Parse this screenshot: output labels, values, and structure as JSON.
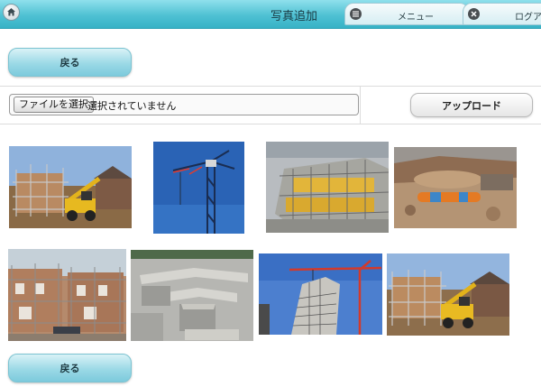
{
  "header": {
    "title": "写真追加",
    "home_icon": "home-icon",
    "tabs": [
      {
        "label": "メニュー",
        "icon": "menu-icon"
      },
      {
        "label": "ログアウト",
        "icon": "close-icon"
      }
    ],
    "colors": {
      "bar": "#4fc1d3",
      "tab": "#eaf7fa"
    }
  },
  "back_button": {
    "label": "戻る"
  },
  "upload_form": {
    "file_button_label": "ファイルを選択",
    "file_status": "選択されていません",
    "upload_button_label": "アップロード"
  },
  "photos": [
    {
      "subject": "scaffolding with yellow telehandler and houses"
    },
    {
      "subject": "blue tower crane against blue sky"
    },
    {
      "subject": "scaffolded building with yellow safety nets"
    },
    {
      "subject": "excavation with orange pipe"
    },
    {
      "subject": "brick houses under scaffolding"
    },
    {
      "subject": "concrete foundation forms"
    },
    {
      "subject": "tall building with red crane"
    },
    {
      "subject": "scaffolding with yellow telehandler"
    }
  ]
}
